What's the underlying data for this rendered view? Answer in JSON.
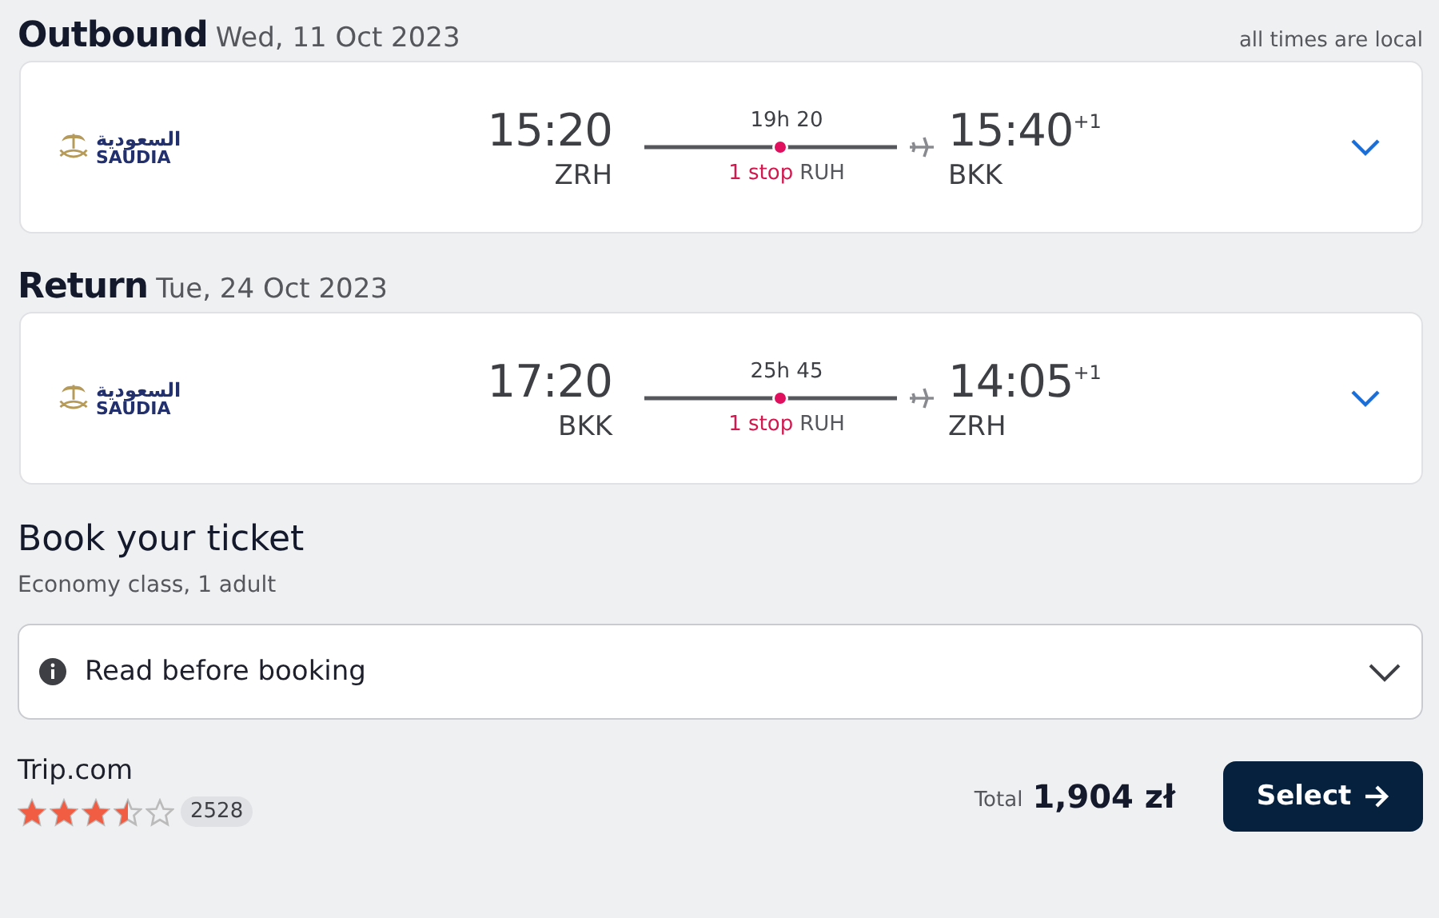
{
  "legs": [
    {
      "title": "Outbound",
      "date": "Wed, 11 Oct 2023",
      "note": "all times are local",
      "airline": {
        "arabic": "السعودية",
        "latin": "SAUDIA"
      },
      "depart_time": "15:20",
      "depart_code": "ZRH",
      "duration": "19h 20",
      "stops": "1 stop",
      "via": "RUH",
      "arrive_time": "15:40",
      "day_offset": "+1",
      "arrive_code": "BKK",
      "expanded": false
    },
    {
      "title": "Return",
      "date": "Tue, 24 Oct 2023",
      "airline": {
        "arabic": "السعودية",
        "latin": "SAUDIA"
      },
      "depart_time": "17:20",
      "depart_code": "BKK",
      "duration": "25h 45",
      "stops": "1 stop",
      "via": "RUH",
      "arrive_time": "14:05",
      "day_offset": "+1",
      "arrive_code": "ZRH",
      "expanded": false
    }
  ],
  "booking": {
    "title": "Book your ticket",
    "subtitle": "Economy class, 1 adult",
    "notice": {
      "label": "Read before booking",
      "expanded": false
    },
    "provider": {
      "name": "Trip.com",
      "stars": 3.5,
      "reviews": "2528"
    },
    "total_label": "Total",
    "total": "1,904 zł",
    "button": "Select"
  }
}
